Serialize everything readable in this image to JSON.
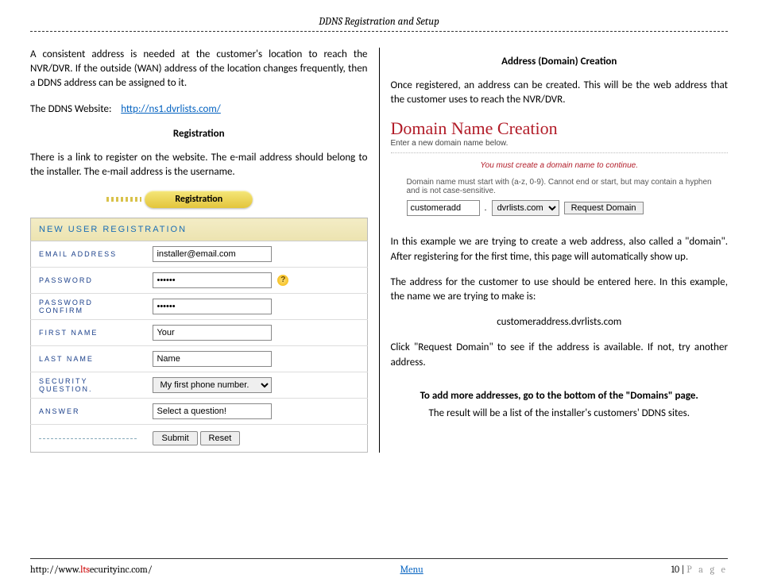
{
  "header": {
    "title": "DDNS Registration and Setup"
  },
  "left": {
    "p1": "A consistent address is needed at the customer's location to reach the NVR/DVR.  If the outside (WAN) address of the location changes frequently, then a DDNS address can be assigned to it.",
    "websiteLabel": "The DDNS Website:",
    "websiteLink": "http://ns1.dvrlists.com/",
    "registrationHead": "Registration",
    "p2": "There is a link to register on the website.  The e-mail address should belong to the installer.  The e-mail address is the username.",
    "regButton": "Registration",
    "form": {
      "title": "NEW USER REGISTRATION",
      "emailLabel": "EMAIL ADDRESS",
      "emailValue": "installer@email.com",
      "passwordLabel": "PASSWORD",
      "passwordValue": "••••••",
      "passwordConfirmLabel": "PASSWORD CONFIRM",
      "passwordConfirmValue": "••••••",
      "firstNameLabel": "FIRST NAME",
      "firstNameValue": "Your",
      "lastNameLabel": "LAST NAME",
      "lastNameValue": "Name",
      "secQLabel": "SECURITY QUESTION.",
      "secQValue": "My first phone number.",
      "answerLabel": "ANSWER",
      "answerValue": "Select a question!",
      "submit": "Submit",
      "reset": "Reset"
    }
  },
  "right": {
    "head": "Address (Domain) Creation",
    "p1": "Once registered, an address can be created.  This will be the web address that the customer uses to reach the NVR/DVR.",
    "dnTitle": "Domain Name Creation",
    "dnSub": "Enter a new domain name below.",
    "warn": "You must create a domain name to continue.",
    "hint": "Domain name must start with (a-z, 0-9). Cannot end or start, but may contain a hyphen and is not case-sensitive.",
    "domainInput": "customeradd",
    "domainSuffix": "dvrlists.com",
    "requestBtn": "Request Domain",
    "p2": "In this example we are trying to create a web address, also called a \"domain\".  After registering for the first time, this page will automatically show up.",
    "p3": "The address for the customer to use should be entered here.  In this example, the name we are trying to make is:",
    "example": "customeraddress.dvrlists.com",
    "p4": "Click \"Request Domain\" to see if the address is available.  If not, try another address.",
    "p5": "To add more addresses, go to the bottom of the \"Domains\" page.",
    "p6": "The result will be a list of the installer's customers' DDNS sites."
  },
  "footer": {
    "urlPrefix": "http://www.",
    "urlRed": "lts",
    "urlSuffix": "ecurityinc.com/",
    "menu": "Menu",
    "pageNum": "10",
    "pageLabel": "P a g e"
  }
}
